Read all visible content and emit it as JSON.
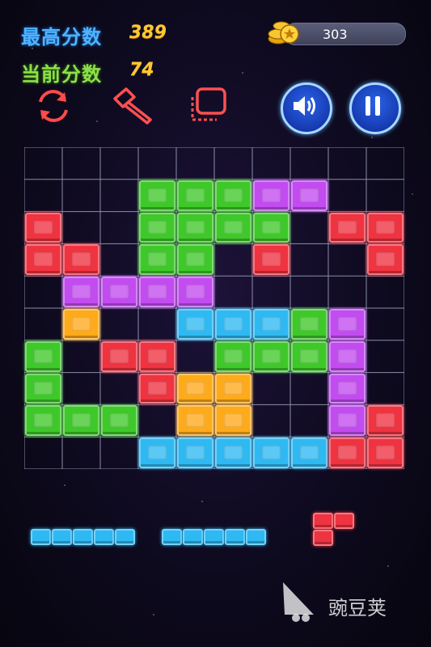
{
  "hud": {
    "best_label": "最高分数",
    "best_score": "389",
    "current_label": "当前分数",
    "current_score": "74",
    "coins": "303"
  },
  "colors": {
    "red": "#ef3340",
    "green": "#3fc82a",
    "purple": "#c24cf0",
    "cyan": "#2fb9f2",
    "orange": "#ffaa1a",
    "grid_line": "#8a8ea8"
  },
  "tools": [
    "rotate-icon",
    "hammer-icon",
    "swap-icon",
    "sound-icon",
    "pause-icon"
  ],
  "board": {
    "cols": 10,
    "rows": 10,
    "cells": [
      ".....GGGPP..",
      "R...GGGG..RR",
      "RR..GG..R..R",
      ".PPPP.......",
      ".O...CCCGP..",
      "G..RR.GGGP..",
      "G...ROO..P..",
      "GGG..OO..PR.",
      "....CCCCCRR."
    ],
    "layout": [
      [
        "",
        "",
        "",
        "G",
        "G",
        "G",
        "P",
        "P",
        "",
        ""
      ],
      [
        "R",
        "",
        "",
        "G",
        "G",
        "G",
        "G",
        "",
        "R",
        "R"
      ],
      [
        "R",
        "R",
        "",
        "G",
        "G",
        "",
        "R",
        "",
        "",
        "R"
      ],
      [
        "",
        "P",
        "P",
        "P",
        "P",
        "",
        "",
        "",
        "",
        ""
      ],
      [
        "",
        "O",
        "",
        "",
        "C",
        "C",
        "C",
        "G",
        "P",
        ""
      ],
      [
        "G",
        "",
        "R",
        "R",
        "",
        "G",
        "G",
        "G",
        "P",
        ""
      ],
      [
        "G",
        "",
        "",
        "R",
        "O",
        "O",
        "",
        "",
        "P",
        ""
      ],
      [
        "G",
        "G",
        "G",
        "",
        "O",
        "O",
        "",
        "",
        "P",
        "R"
      ],
      [
        "",
        "",
        "",
        "C",
        "C",
        "C",
        "C",
        "C",
        "R",
        "R"
      ]
    ]
  },
  "pieces": [
    {
      "color": "cyan",
      "shape": "1x5-horizontal"
    },
    {
      "color": "cyan",
      "shape": "1x5-horizontal"
    },
    {
      "color": "red",
      "shape": "L-small"
    }
  ],
  "watermark": "豌豆荚"
}
